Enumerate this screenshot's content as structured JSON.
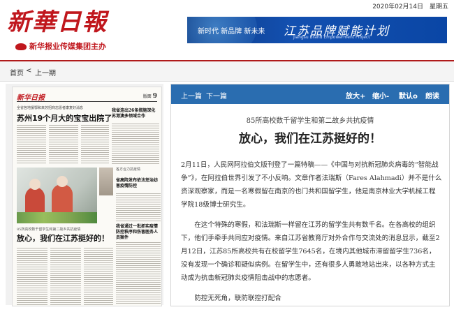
{
  "header": {
    "logo_text": "新華日報",
    "sub_logo": "新华报业传媒集团主办",
    "date": "2020年02月14日　星期五",
    "banner": {
      "slogan": "新时代  新品牌  新未来",
      "title": "江苏品牌赋能计划",
      "subtitle": "Jiangsu Brand Empowerment Project"
    }
  },
  "nav": {
    "home": "首页",
    "separator": "<",
    "prev": "上一期"
  },
  "newspaper_preview": {
    "masthead": "新华日报",
    "page_label": "版面",
    "page_number": "9",
    "top_kicker": "全省各地援鄂和来苏招商志愿者康复好消息",
    "headline1": "苏州19个月大的宝宝出院了",
    "side_headline1": "我省连出26条措施深化苏港澳多领域合作",
    "side_kicker2": "各方合力抗疫情",
    "side_headline2": "省高院发布依法惩治妨害疫情防控",
    "kicker3": "85所高校数千留学生和第二故乡共抗疫情",
    "headline3": "放心，我们在江苏挺好的！",
    "side_headline3": "我省通过一批抓实疫情防控秩序和伤害医务人员案件"
  },
  "toolbar": {
    "prev": "上一篇",
    "next": "下一篇",
    "zoom_in": "放大+",
    "zoom_out": "缩小-",
    "default": "默认o",
    "read": "朗读"
  },
  "article": {
    "subtitle": "85所高校数千留学生和第二故乡共抗疫情",
    "title": "放心，我们在江苏挺好的！",
    "paragraphs": [
      "2月11日，人民网阿拉伯文版刊登了一篇特稿——《中国与对抗新冠肺炎病毒的“智能战争”》，在阿拉伯世界引发了不小反响。文章作者法瑞斯（Fares Alahmadi）并不是什么资深观察家，而是一名寒假留在南京的也门共和国留学生，他是南京林业大学机械工程学院18级博士研究生。",
      "在这个特殊的寒假，和法瑞斯一样留在江苏的留学生共有数千名。在各高校的组织下，他们手牵手共同应对疫情。来自江苏省教育厅对外合作与交流处的消息显示，截至2月12日，江苏85所高校共有在校留学生7645名，在境内其他城市滞留留学生736名，没有发现一个确诊和疑似病例。在留学生中，还有很多人勇敢地站出来，以各种方式主动成为抗击新冠肺炎疫情阻击战中的志愿者。",
      "防控无死角，联防联控打配合"
    ]
  }
}
